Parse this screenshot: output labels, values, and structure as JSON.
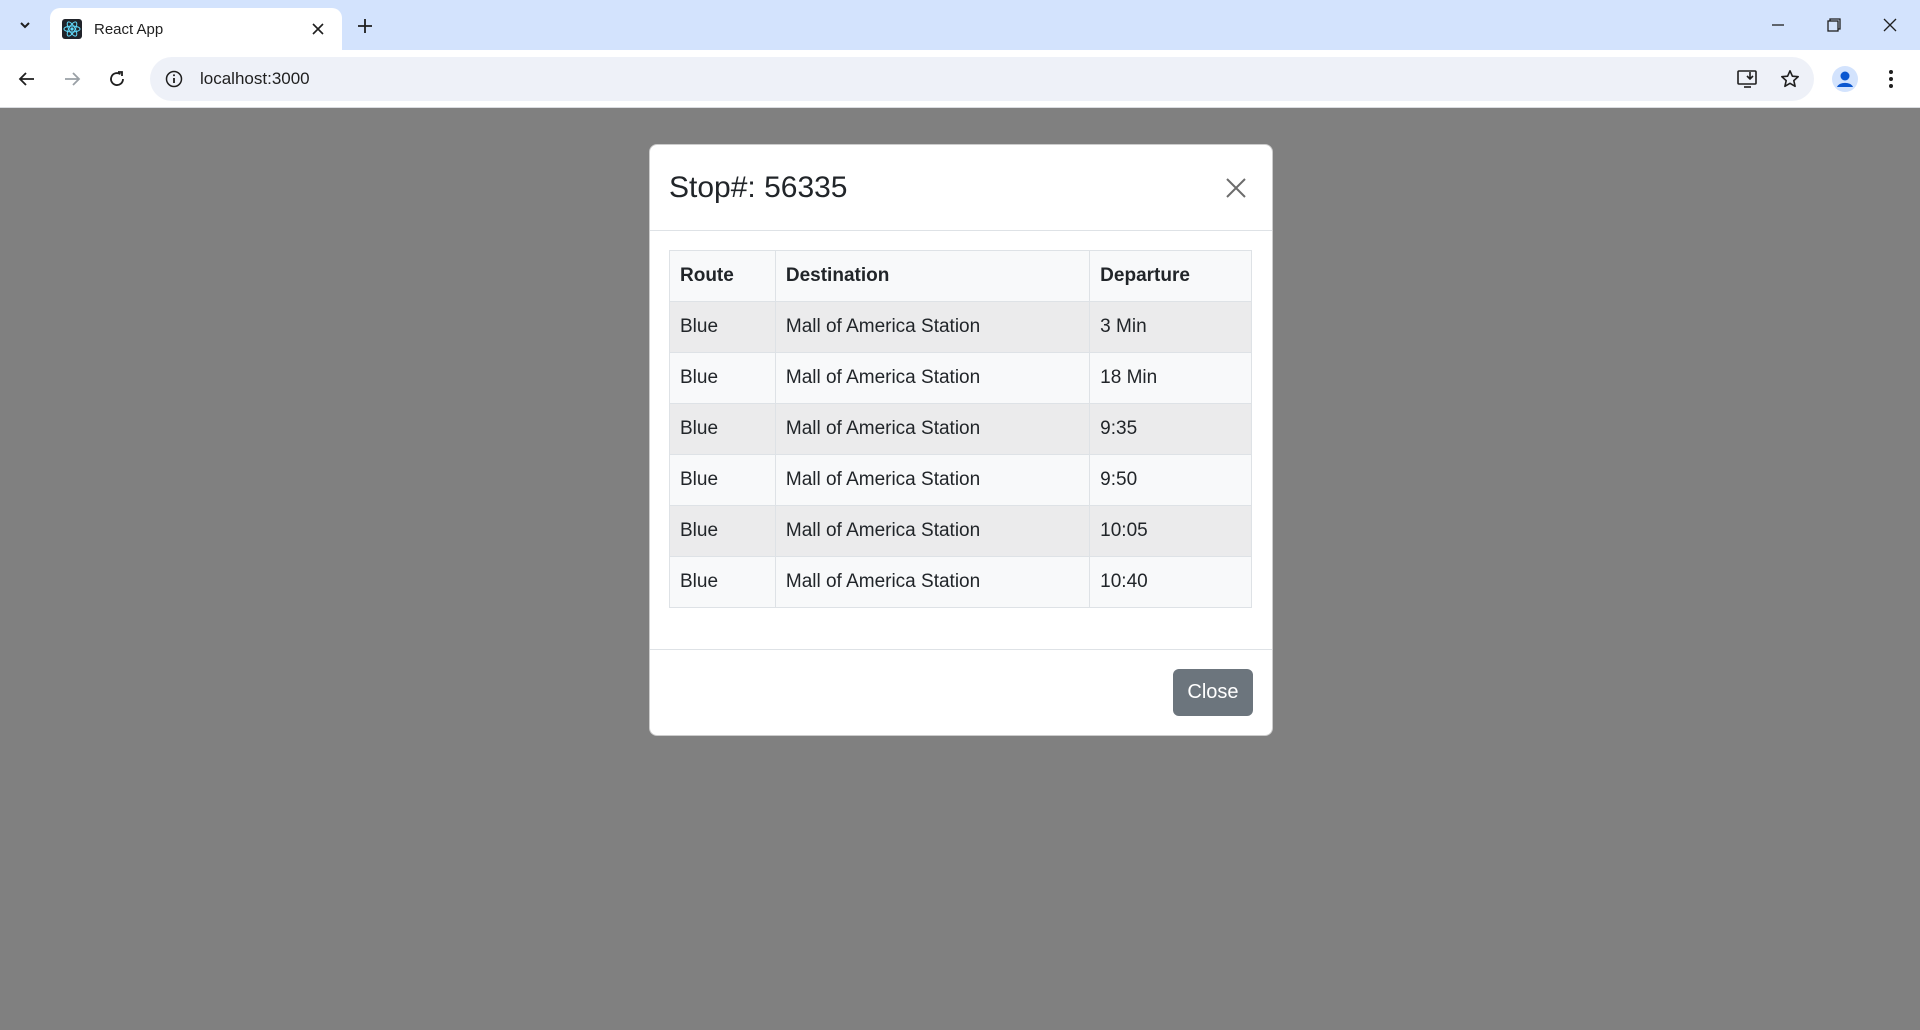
{
  "browser": {
    "tab_title": "React App",
    "url": "localhost:3000"
  },
  "modal": {
    "title": "Stop#: 56335",
    "table": {
      "headers": [
        "Route",
        "Destination",
        "Departure"
      ],
      "rows": [
        [
          "Blue",
          "Mall of America Station",
          "3 Min"
        ],
        [
          "Blue",
          "Mall of America Station",
          "18 Min"
        ],
        [
          "Blue",
          "Mall of America Station",
          "9:35"
        ],
        [
          "Blue",
          "Mall of America Station",
          "9:50"
        ],
        [
          "Blue",
          "Mall of America Station",
          "10:05"
        ],
        [
          "Blue",
          "Mall of America Station",
          "10:40"
        ]
      ]
    },
    "close_label": "Close"
  },
  "colors": {
    "backdrop": "#808080",
    "close_button": "#6c757d",
    "tabstrip": "#d3e3fd"
  }
}
